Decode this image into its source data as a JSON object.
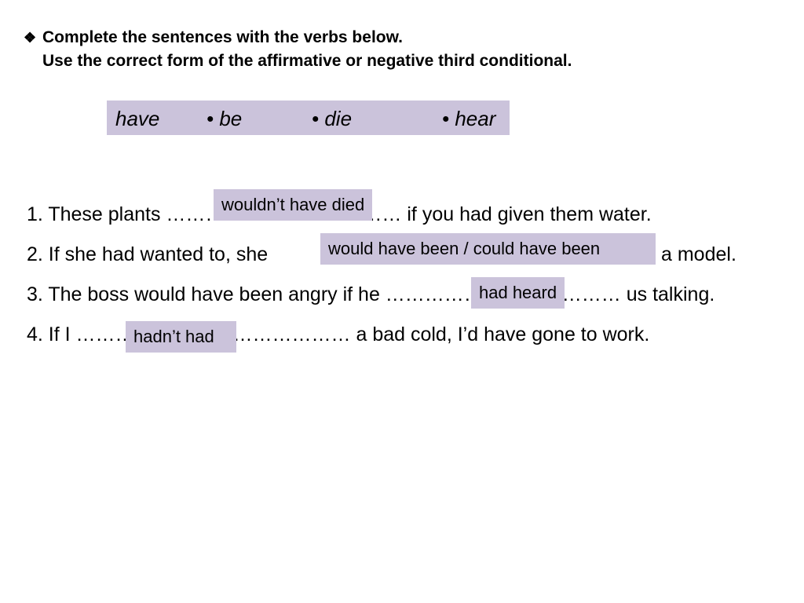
{
  "instructions": {
    "bullet_icon": "❖",
    "line1": "Complete the sentences with the verbs below.",
    "line2": "Use the correct form of the affirmative  or negative third conditional."
  },
  "verbs": [
    "have",
    "• be",
    "• die",
    "• hear"
  ],
  "sentences": [
    {
      "text": "1. These plants ……………………………… if you had given them water.",
      "answer": "wouldn’t have died"
    },
    {
      "text": "2.  If she had wanted to, she",
      "suffix": "a model.",
      "answer": "would have been / could have been"
    },
    {
      "text": "3.  The boss would have been angry if he ……………………………… us talking.",
      "answer": "had heard"
    },
    {
      "text": "4.  If I …………………………………… a bad cold, I’d have gone to work.",
      "answer": "hadn’t had"
    }
  ],
  "colors": {
    "highlight": "#cbc3db"
  }
}
